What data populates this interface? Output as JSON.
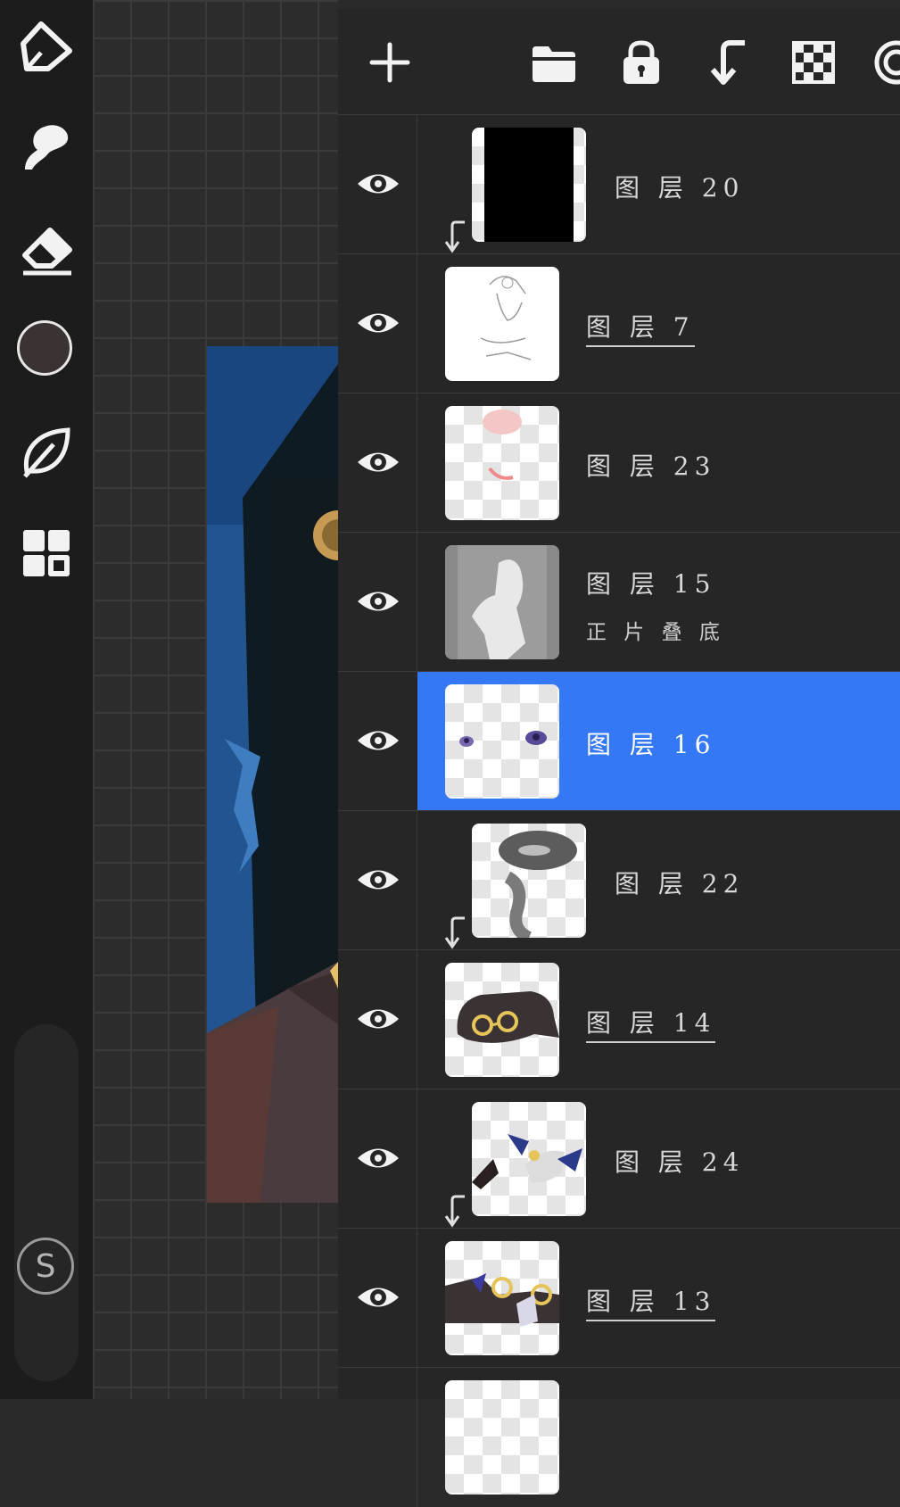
{
  "layers": [
    {
      "name": "图 层 20",
      "blend": "",
      "clipped": true,
      "underline": false,
      "selected": false
    },
    {
      "name": "图 层 7",
      "blend": "",
      "clipped": false,
      "underline": true,
      "selected": false
    },
    {
      "name": "图 层 23",
      "blend": "",
      "clipped": false,
      "underline": false,
      "selected": false
    },
    {
      "name": "图 层 15",
      "blend": "正 片 叠 底",
      "clipped": false,
      "underline": false,
      "selected": false
    },
    {
      "name": "图 层 16",
      "blend": "",
      "clipped": false,
      "underline": false,
      "selected": true
    },
    {
      "name": "图 层 22",
      "blend": "",
      "clipped": true,
      "underline": false,
      "selected": false
    },
    {
      "name": "图 层 14",
      "blend": "",
      "clipped": false,
      "underline": true,
      "selected": false
    },
    {
      "name": "图 层 24",
      "blend": "",
      "clipped": true,
      "underline": false,
      "selected": false
    },
    {
      "name": "图 层 13",
      "blend": "",
      "clipped": false,
      "underline": true,
      "selected": false
    }
  ],
  "tools": {
    "icons": [
      "pen-icon",
      "smudge-icon",
      "eraser-icon",
      "color-icon",
      "leaf-icon",
      "gallery-icon"
    ],
    "s_button_label": "S"
  },
  "colors": {
    "selected": "#3478f6",
    "panel": "#262626",
    "current_color": "#3b3234"
  }
}
